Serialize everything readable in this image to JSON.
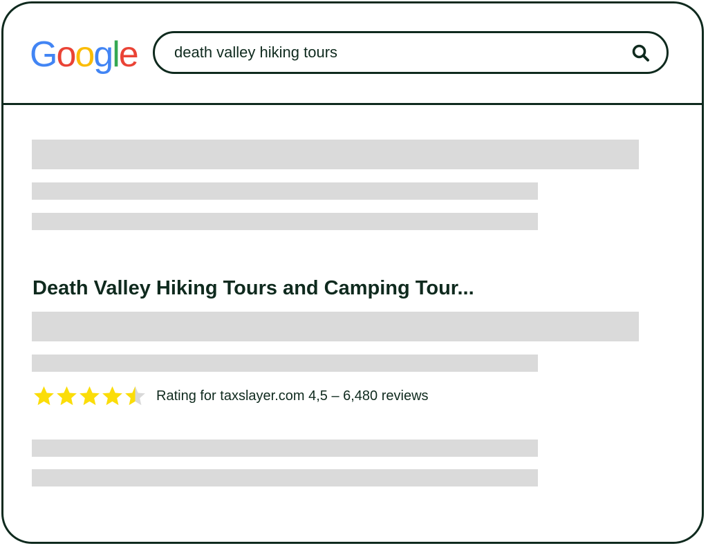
{
  "logo": {
    "letters": [
      "G",
      "o",
      "o",
      "g",
      "l",
      "e"
    ],
    "colors": [
      "#4285F4",
      "#EA4335",
      "#FBBC05",
      "#4285F4",
      "#34A853",
      "#EA4335"
    ]
  },
  "search": {
    "query": "death valley hiking tours",
    "button_icon": "search-icon"
  },
  "result": {
    "title": "Death Valley Hiking Tours and Camping Tour...",
    "rating": {
      "value": 4.5,
      "max": 5,
      "text": "Rating for taxslayer.com 4,5 – 6,480 reviews",
      "star_color": "#FBDD09",
      "empty_star_color": "#D9D9D9"
    }
  },
  "colors": {
    "ink": "#0f2a1e",
    "placeholder_bar": "#dadada"
  }
}
